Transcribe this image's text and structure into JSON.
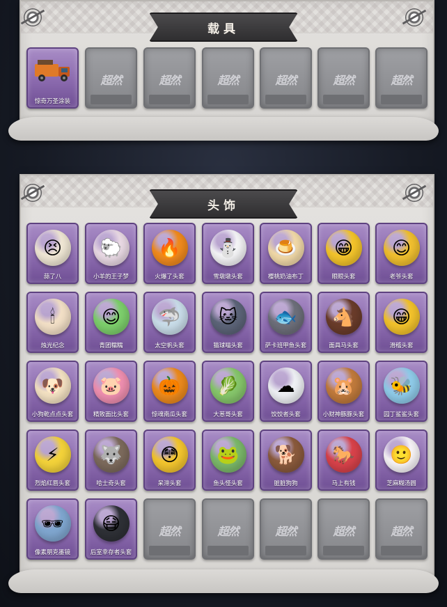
{
  "vehicle_section": {
    "title": "载具",
    "items": [
      {
        "label": "惊奇万圣涂装",
        "icon": "truck-icon",
        "color": "#e07a28"
      }
    ],
    "empty_slots": 6
  },
  "headwear_section": {
    "title": "头饰",
    "items": [
      {
        "label": "蒜了八",
        "icon": "garlic-icon",
        "glyph": "😣",
        "color": "#efe6d4"
      },
      {
        "label": "小羊的王子梦",
        "icon": "sheep-icon",
        "glyph": "🐑",
        "color": "#e9d9e4"
      },
      {
        "label": "火爆了头套",
        "icon": "fire-icon",
        "glyph": "🔥",
        "color": "#f08a1e"
      },
      {
        "label": "雪墩墩头套",
        "icon": "snowman-icon",
        "glyph": "⛄",
        "color": "#f4f4f6"
      },
      {
        "label": "樱桃奶油布丁",
        "icon": "pudding-icon",
        "glyph": "🍮",
        "color": "#f1d9a8"
      },
      {
        "label": "眼眼头套",
        "icon": "grin-icon",
        "glyph": "😁",
        "color": "#f3c42b"
      },
      {
        "label": "老爷头套",
        "icon": "smile-icon",
        "glyph": "😊",
        "color": "#f0bf2f"
      },
      {
        "label": "烛光纪念",
        "icon": "candle-icon",
        "glyph": "🕯",
        "color": "#f2dfc6"
      },
      {
        "label": "青团糯糯",
        "icon": "dumpling-icon",
        "glyph": "😊",
        "color": "#7dcf6c"
      },
      {
        "label": "太空帆头套",
        "icon": "shark-icon",
        "glyph": "🦈",
        "color": "#c9dde9"
      },
      {
        "label": "猫球喵头套",
        "icon": "cat-icon",
        "glyph": "🐱",
        "color": "#5c6478"
      },
      {
        "label": "萨卡班甲鱼头套",
        "icon": "fish-icon",
        "glyph": "🐟",
        "color": "#6d6f7a"
      },
      {
        "label": "面具马头套",
        "icon": "horse-icon",
        "glyph": "🐴",
        "color": "#6a3c2a"
      },
      {
        "label": "滑稽头套",
        "icon": "funny-face-icon",
        "glyph": "😁",
        "color": "#f2c22c"
      },
      {
        "label": "小狗乾点点头套",
        "icon": "dog-icon",
        "glyph": "🐶",
        "color": "#f3e1c2"
      },
      {
        "label": "精致面比头套",
        "icon": "pig-icon",
        "glyph": "🐷",
        "color": "#ef8fb0"
      },
      {
        "label": "惊魂南瓜头套",
        "icon": "pumpkin-icon",
        "glyph": "🎃",
        "color": "#ec8a1e"
      },
      {
        "label": "大葱哥头套",
        "icon": "scallion-icon",
        "glyph": "🥬",
        "color": "#86c66b"
      },
      {
        "label": "饺饺者头套",
        "icon": "cloud-icon",
        "glyph": "☁",
        "color": "#eef0f4"
      },
      {
        "label": "小财神豚豚头套",
        "icon": "capybara-icon",
        "glyph": "🐹",
        "color": "#c07a3c"
      },
      {
        "label": "园丁鲨鲨头套",
        "icon": "bee-shark-icon",
        "glyph": "🐝",
        "color": "#8fcbe9"
      },
      {
        "label": "烈焰红唇头套",
        "icon": "pikachu-icon",
        "glyph": "⚡",
        "color": "#f3d23a"
      },
      {
        "label": "哈士奇头套",
        "icon": "husky-icon",
        "glyph": "🐺",
        "color": "#7c6a5c"
      },
      {
        "label": "呆滞头套",
        "icon": "dazed-face-icon",
        "glyph": "😳",
        "color": "#f3c52e"
      },
      {
        "label": "鱼头怪头套",
        "icon": "fishman-icon",
        "glyph": "🐸",
        "color": "#7bb86a"
      },
      {
        "label": "脏脏狗狗",
        "icon": "puppy-icon",
        "glyph": "🐕",
        "color": "#8a5a3c"
      },
      {
        "label": "马上有钱",
        "icon": "red-horse-icon",
        "glyph": "🐎",
        "color": "#d8424a"
      },
      {
        "label": "芝麻糊汤圆",
        "icon": "tangyuan-icon",
        "glyph": "🙂",
        "color": "#f6f3f6"
      },
      {
        "label": "像素朋克墨镜",
        "icon": "pixel-sunglasses-icon",
        "glyph": "🕶",
        "color": "#7fa6cf"
      },
      {
        "label": "后室幸存者头套",
        "icon": "gas-mask-icon",
        "glyph": "😷",
        "color": "#2e3036"
      }
    ],
    "empty_slots": 5
  },
  "watermark_text": "超然",
  "colors": {
    "slot_filled": "#8b6aae",
    "slot_empty": "#85868a",
    "panel": "#dcdad7",
    "banner": "#3a393b"
  }
}
